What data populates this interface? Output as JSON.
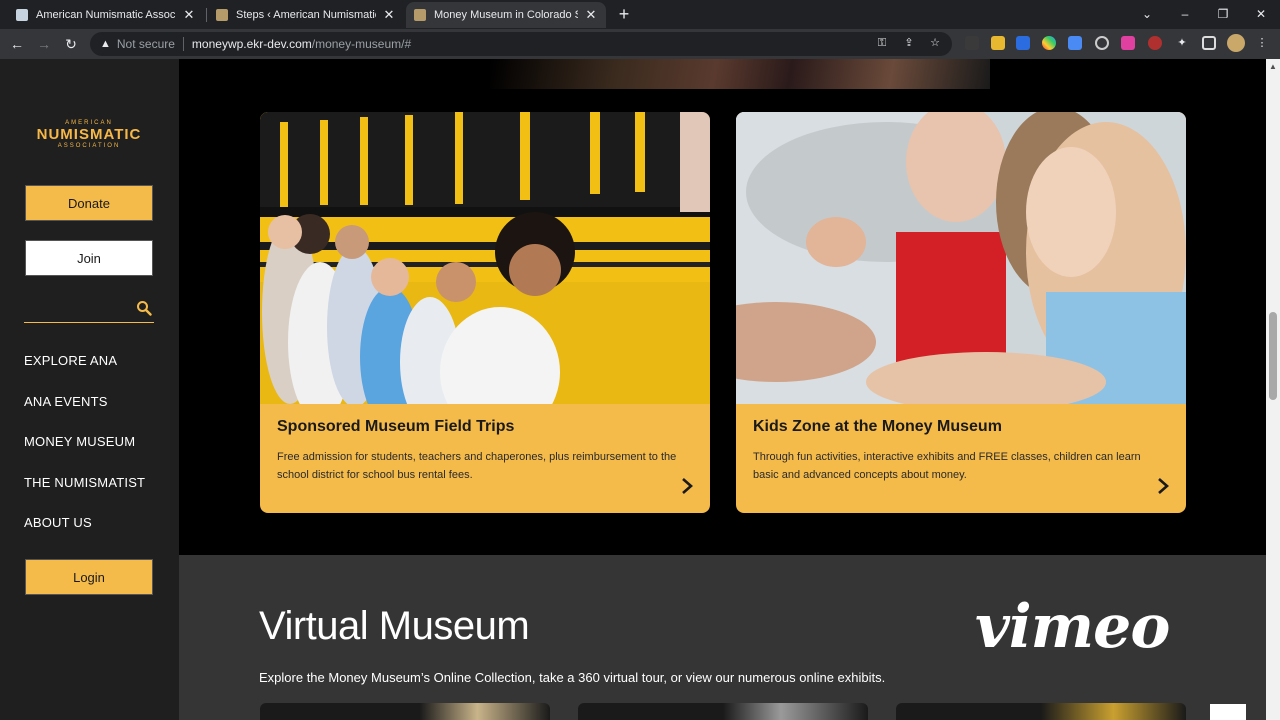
{
  "browser": {
    "tabs": [
      {
        "title": "American Numismatic Associatio",
        "active": false
      },
      {
        "title": "Steps ‹ American Numismatic As",
        "active": false
      },
      {
        "title": "Money Museum in Colorado Spri",
        "active": true
      }
    ],
    "new_tab_icon": "+",
    "window_controls": [
      "⌄",
      "–",
      "❐",
      "✕"
    ],
    "security_label": "Not secure",
    "url_host": "moneywp.ekr-dev.com",
    "url_path": "/money-museum/#"
  },
  "sidebar": {
    "logo": {
      "line1": "AMERICAN",
      "line2": "NUMISMATIC",
      "line3": "ASSOCIATION"
    },
    "donate_label": "Donate",
    "join_label": "Join",
    "search_placeholder": "",
    "nav": [
      "EXPLORE ANA",
      "ANA EVENTS",
      "MONEY MUSEUM",
      "THE NUMISMATIST",
      "ABOUT US"
    ],
    "login_label": "Login"
  },
  "cards": [
    {
      "title": "Sponsored Museum Field Trips",
      "description": "Free admission for students, teachers and chaperones, plus reimbursement to the school district for school bus rental fees."
    },
    {
      "title": "Kids Zone at the Money Museum",
      "description": "Through fun activities, interactive exhibits and FREE classes, children can learn basic and advanced concepts about money."
    }
  ],
  "virtual_museum": {
    "title": "Virtual Museum",
    "subtitle": "Explore the Money Museum’s Online Collection, take a 360 virtual tour, or view our numerous online exhibits."
  },
  "watermark": "vimeo",
  "colors": {
    "accent": "#f5bb4a",
    "sidebar_bg": "#1f1f1f",
    "lower_bg": "#353535"
  }
}
